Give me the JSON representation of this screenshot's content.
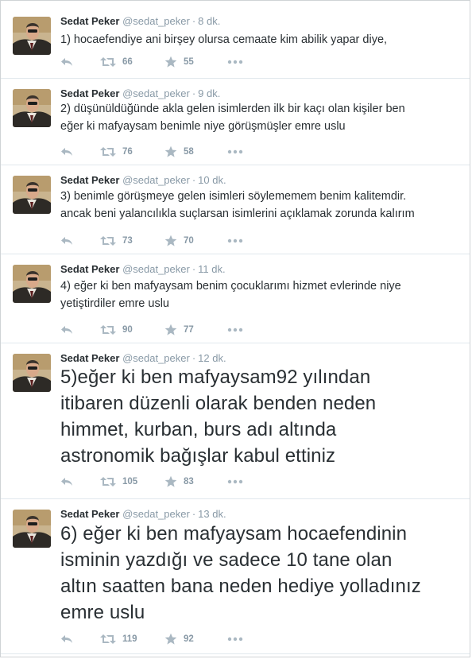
{
  "tweets": [
    {
      "name": "Sedat Peker",
      "handle": "@sedat_peker",
      "time": "8 dk.",
      "size": "small",
      "text": [
        "1) hocaefendiye ani birşey olursa cemaate kim abilik yapar diye,"
      ],
      "retweets": "66",
      "favorites": "55"
    },
    {
      "name": "Sedat Peker",
      "handle": "@sedat_peker",
      "time": "9 dk.",
      "size": "small",
      "text": [
        "2) düşünüldüğünde akla gelen isimlerden ilk bir kaçı olan kişiler ben",
        "eğer ki mafyaysam benimle niye görüşmüşler emre uslu"
      ],
      "retweets": "76",
      "favorites": "58"
    },
    {
      "name": "Sedat Peker",
      "handle": "@sedat_peker",
      "time": "10 dk.",
      "size": "small",
      "text": [
        "3) benimle görüşmeye gelen isimleri söylememem benim kalitemdir.",
        "ancak beni yalancılıkla suçlarsan isimlerini açıklamak zorunda kalırım"
      ],
      "retweets": "73",
      "favorites": "70"
    },
    {
      "name": "Sedat Peker",
      "handle": "@sedat_peker",
      "time": "11 dk.",
      "size": "small",
      "text": [
        "4) eğer ki ben mafyaysam benim çocuklarımı hizmet evlerinde niye",
        "yetiştirdiler emre uslu"
      ],
      "retweets": "90",
      "favorites": "77"
    },
    {
      "name": "Sedat Peker",
      "handle": "@sedat_peker",
      "time": "12 dk.",
      "size": "big",
      "text": [
        "5)eğer ki ben mafyaysam92 yılından",
        "itibaren düzenli olarak benden neden",
        "himmet, kurban, burs adı altında",
        "astronomik bağışlar kabul ettiniz"
      ],
      "retweets": "105",
      "favorites": "83"
    },
    {
      "name": "Sedat Peker",
      "handle": "@sedat_peker",
      "time": "13 dk.",
      "size": "big",
      "text": [
        "6) eğer ki ben mafyaysam hocaefendinin",
        "isminin yazdığı ve sadece 10 tane olan",
        "altın saatten bana neden hediye yolladınız",
        "emre uslu"
      ],
      "retweets": "119",
      "favorites": "92"
    }
  ],
  "icons": {
    "reply": "reply-icon",
    "retweet": "retweet-icon",
    "favorite": "star-icon",
    "more": "more-icon",
    "avatar": "avatar"
  },
  "colors": {
    "action_gray": "#aab8c2",
    "meta_gray": "#8899a6",
    "text": "#292f33",
    "divider": "#e1e8ed"
  }
}
